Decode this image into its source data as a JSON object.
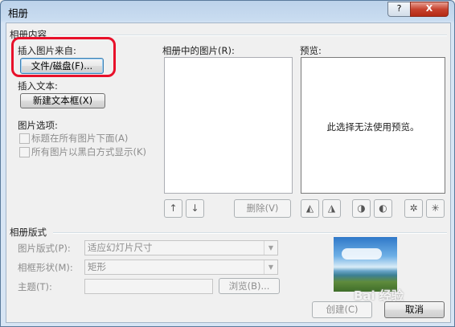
{
  "window": {
    "title": "相册",
    "help": "?",
    "close": "X"
  },
  "album_content": {
    "group_title": "相册内容",
    "insert_picture_from": "插入图片来自:",
    "file_disk_button": "文件/磁盘(F)...",
    "insert_text": "插入文本:",
    "new_textbox_button": "新建文本框(X)",
    "picture_options": "图片选项:",
    "caption_below_all": "标题在所有图片下面(A)",
    "all_black_white": "所有图片以黑白方式显示(K)"
  },
  "pictures_in_album": {
    "label": "相册中的图片(R):"
  },
  "preview": {
    "label": "预览:",
    "message": "此选择无法使用预览。"
  },
  "list_buttons": {
    "up": "↑",
    "down": "↓",
    "delete": "删除(V)"
  },
  "layout": {
    "group_title": "相册版式",
    "picture_layout_label": "图片版式(P):",
    "picture_layout_value": "适应幻灯片尺寸",
    "frame_shape_label": "相框形状(M):",
    "frame_shape_value": "矩形",
    "theme_label": "主题(T):",
    "browse_button": "浏览(B)..."
  },
  "footer": {
    "create_button": "创建(C)",
    "cancel_button": "取消"
  },
  "watermark": "Bai 经验"
}
